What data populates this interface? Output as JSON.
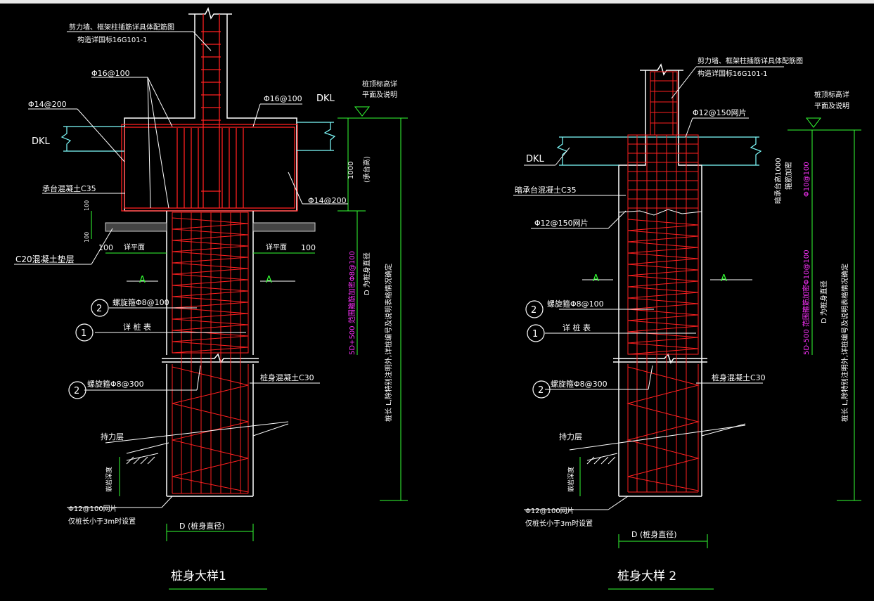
{
  "colors": {
    "background": "#000000",
    "rebar": "#ff2020",
    "outline": "#ffffff",
    "dimension": "#33ff33",
    "leader": "#7fffff",
    "highlight": "#ff33ff",
    "bolt": "#ffff33"
  },
  "detail1": {
    "title": "桩身大样1",
    "note_wall_line1": "剪力墙、框架柱插筋详具体配筋图",
    "note_wall_line2": "构造详国标16G101-1",
    "label_phi16_a": "Φ16@100",
    "label_phi16_b": "Φ16@100",
    "label_phi14_a": "Φ14@200",
    "label_phi14_b": "Φ14@200",
    "label_dkl_left": "DKL",
    "label_dkl_right": "DKL",
    "label_cap_concrete": "承台混凝土C35",
    "label_c20": "C20混凝土垫层",
    "label_100_left": "100",
    "label_100_right": "100",
    "label_detail_plane_l": "详平面",
    "label_detail_plane_r": "详平面",
    "label_A_left": "A",
    "label_A_right": "A",
    "circle_2a": "2",
    "label_spiral_100": "螺旋箍Φ8@100",
    "circle_1": "1",
    "label_pile_table": "详 桩 表",
    "circle_2b": "2",
    "label_spiral_300": "螺旋箍Φ8@300",
    "label_pile_concrete": "桩身混凝土C30",
    "label_bearing": "持力层",
    "label_embed": "嵌岩深度",
    "label_mesh_1": "Φ12@100网片",
    "label_mesh_2": "仅桩长小于3m时设置",
    "label_d": "D (桩身直径)",
    "label_top_elev_1": "桩顶标高详",
    "label_top_elev_2": "平面及说明",
    "label_1000": "1000",
    "label_cap_height": "(承台高)",
    "label_100_small": "100",
    "label_100_small2": "100",
    "label_D_dir": "D 为桩身直径",
    "label_5d": "5D+500 范围箍筋加密Φ8@100",
    "label_pile_length": "桩长 L,除特别注明外,详桩编号及说明表格情况确定"
  },
  "detail2": {
    "title": "桩身大样 2",
    "note_wall_line1": "剪力墙、框架柱插筋详具体配筋图",
    "note_wall_line2": "构造详国标16G101-1",
    "label_top_elev_1": "桩顶标高详",
    "label_top_elev_2": "平面及说明",
    "label_mesh_150_top": "Φ12@150网片",
    "label_dkl": "DKL",
    "label_hidden_cap": "暗承台混凝土C35",
    "label_mesh_150": "Φ12@150网片",
    "label_hidden_cap_height": "暗承台高1000",
    "label_hidden_cap_stirrup": "箍筋加密",
    "label_phi10": "Φ10@100",
    "label_A_left": "A",
    "label_A_right": "A",
    "circle_2a": "2",
    "label_spiral_100": "螺旋箍Φ8@100",
    "circle_1": "1",
    "label_pile_table": "详 桩 表",
    "circle_2b": "2",
    "label_spiral_300": "螺旋箍Φ8@300",
    "label_pile_concrete": "桩身混凝土C30",
    "label_bearing": "持力层",
    "label_embed": "嵌岩深度",
    "label_mesh_1": "Φ12@100网片",
    "label_mesh_2": "仅桩长小于3m时设置",
    "label_d": "D (桩身直径)",
    "label_D_dir": "D 为桩身直径",
    "label_5d": "5D-500 范围箍筋加密Φ10@100",
    "label_pile_length": "桩长 L,除特别注明外,详桩编号及说明表格情况确定"
  }
}
